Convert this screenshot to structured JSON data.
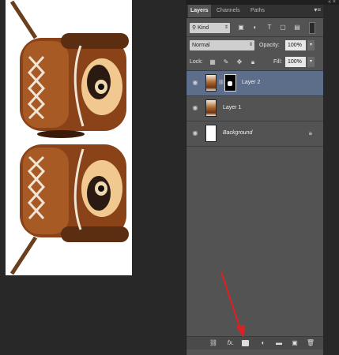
{
  "panel": {
    "tabs": [
      {
        "label": "Layers",
        "active": true
      },
      {
        "label": "Channels",
        "active": false
      },
      {
        "label": "Paths",
        "active": false
      }
    ],
    "filter": {
      "kind_label": "Kind"
    },
    "blend": {
      "mode": "Normal",
      "opacity_label": "Opacity:",
      "opacity_value": "100%"
    },
    "lock": {
      "label": "Lock:",
      "fill_label": "Fill:",
      "fill_value": "100%"
    },
    "layers": [
      {
        "name": "Layer 2",
        "selected": true,
        "has_mask": true,
        "locked": false
      },
      {
        "name": "Layer 1",
        "selected": false,
        "has_mask": false,
        "locked": false
      },
      {
        "name": "Background",
        "selected": false,
        "has_mask": false,
        "locked": true
      }
    ],
    "footer_buttons": [
      "link-icon",
      "fx-icon",
      "mask-icon",
      "adjustment-icon",
      "folder-icon",
      "new-layer-icon",
      "trash-icon"
    ],
    "fx_label": "fx."
  },
  "colors": {
    "selected_layer": "#5d6e8a",
    "panel_bg": "#535353",
    "app_bg": "#282828",
    "annotation_arrow": "#e02020"
  }
}
